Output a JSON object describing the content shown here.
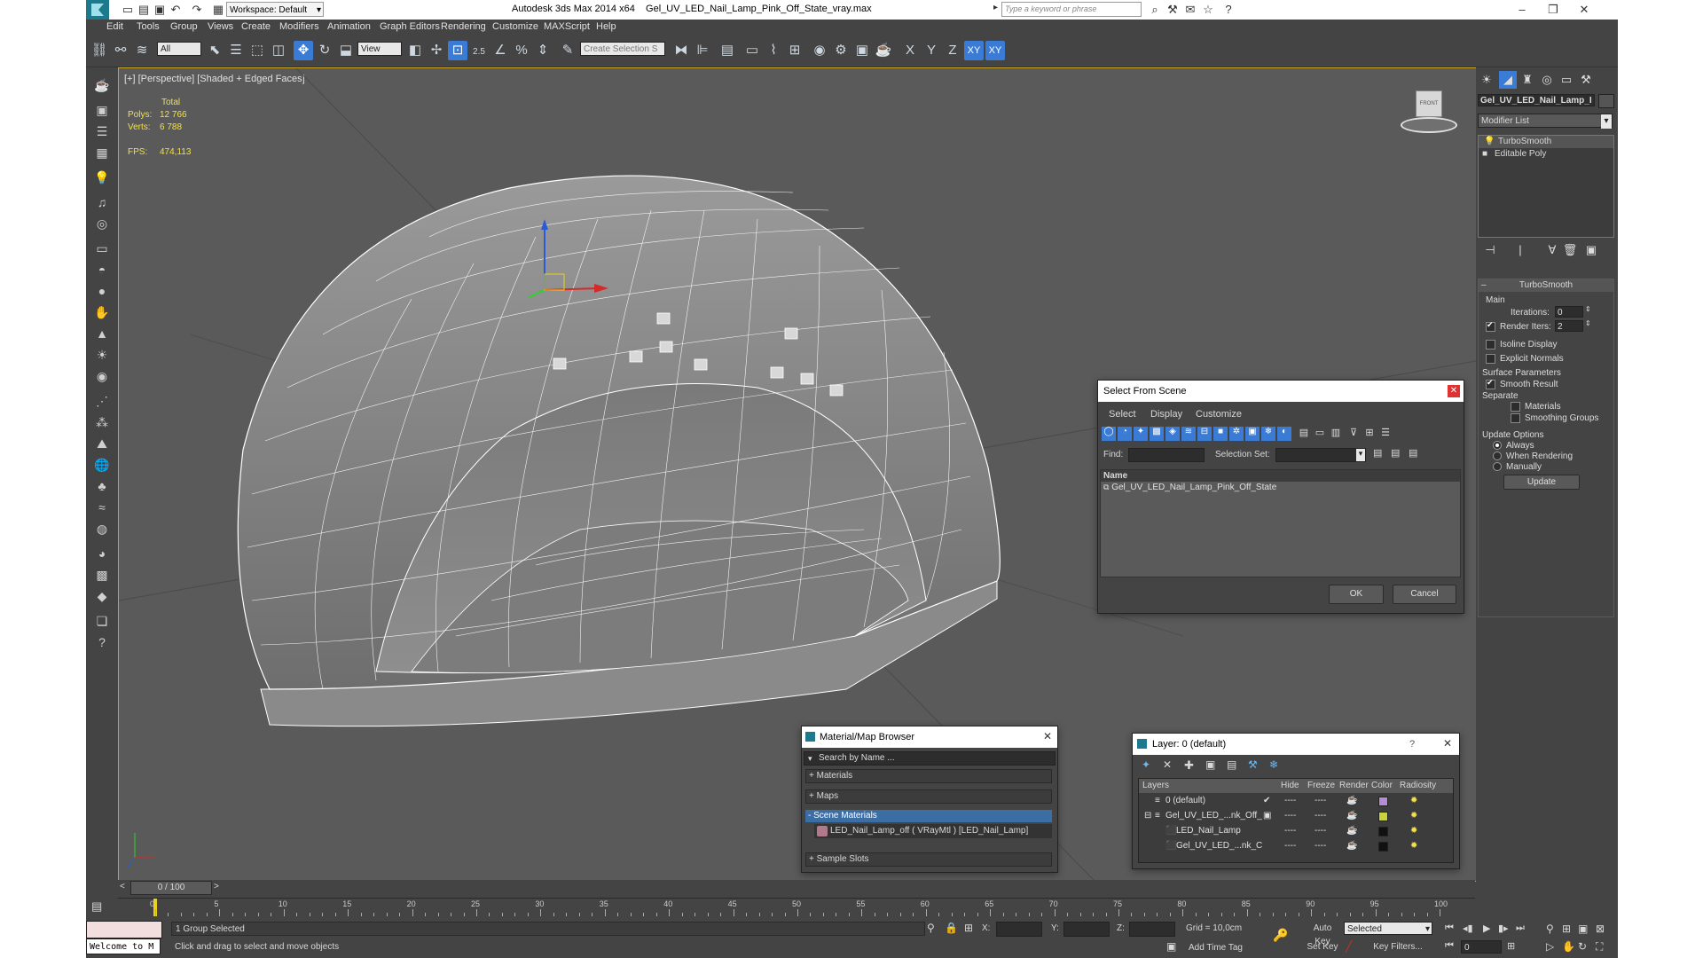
{
  "app": {
    "title": "Autodesk 3ds Max  2014 x64",
    "filename": "Gel_UV_LED_Nail_Lamp_Pink_Off_State_vray.max",
    "workspace": "Workspace: Default",
    "search_placeholder": "Type a keyword or phrase"
  },
  "menu": [
    "Edit",
    "Tools",
    "Group",
    "Views",
    "Create",
    "Modifiers",
    "Animation",
    "Graph Editors",
    "Rendering",
    "Customize",
    "MAXScript",
    "Help"
  ],
  "toolbar": {
    "filter_select": "All",
    "refcoord_select": "View",
    "snap_label": "2.5",
    "selection_set_placeholder": "Create Selection S",
    "axis_buttons": [
      "X",
      "Y",
      "Z",
      "XY",
      "XY"
    ]
  },
  "viewport": {
    "label": "[+] [Perspective] [Shaded + Edged Faces]",
    "stats": {
      "total_label": "Total",
      "polys_label": "Polys:",
      "polys_value": "12 766",
      "verts_label": "Verts:",
      "verts_value": "6 788",
      "fps_label": "FPS:",
      "fps_value": "474,113"
    },
    "viewcube_label": "FRONT"
  },
  "command_panel": {
    "object_name": "Gel_UV_LED_Nail_Lamp_I",
    "modifier_list": "Modifier List",
    "stack": [
      "TurboSmooth",
      "Editable Poly"
    ],
    "rollout_title": "TurboSmooth",
    "main_label": "Main",
    "iterations_label": "Iterations:",
    "iterations_value": "0",
    "render_iters_label": "Render Iters:",
    "render_iters_value": "2",
    "isoline_label": "Isoline Display",
    "explicit_normals_label": "Explicit Normals",
    "surface_params_label": "Surface Parameters",
    "smooth_result_label": "Smooth Result",
    "separate_label": "Separate",
    "materials_label": "Materials",
    "smoothing_groups_label": "Smoothing Groups",
    "update_options_label": "Update Options",
    "always_label": "Always",
    "when_rendering_label": "When Rendering",
    "manually_label": "Manually",
    "update_button": "Update"
  },
  "select_from_scene": {
    "title": "Select From Scene",
    "menu": [
      "Select",
      "Display",
      "Customize"
    ],
    "find_label": "Find:",
    "selection_set_label": "Selection Set:",
    "column_name": "Name",
    "items": [
      "Gel_UV_LED_Nail_Lamp_Pink_Off_State"
    ],
    "ok": "OK",
    "cancel": "Cancel"
  },
  "material_browser": {
    "title": "Material/Map Browser",
    "search_placeholder": "Search by Name ...",
    "sections": [
      "+ Materials",
      "+ Maps",
      "- Scene Materials"
    ],
    "scene_material": "LED_Nail_Lamp_off  ( VRayMtl ) [LED_Nail_Lamp]",
    "sample_slots": "+ Sample Slots"
  },
  "layer_dialog": {
    "title": "Layer: 0 (default)",
    "help": "?",
    "columns": [
      "Layers",
      "Hide",
      "Freeze",
      "Render",
      "Color",
      "Radiosity"
    ],
    "rows": [
      {
        "name": "0 (default)",
        "color": "#b48cd8"
      },
      {
        "name": "Gel_UV_LED_...nk_Off_",
        "color": "#c8d23c"
      },
      {
        "name": "LED_Nail_Lamp",
        "color": "#111111"
      },
      {
        "name": "Gel_UV_LED_...nk_C",
        "color": "#111111"
      }
    ]
  },
  "timeline": {
    "frame_counter": "0 / 100",
    "ticks": [
      "0",
      "5",
      "10",
      "15",
      "20",
      "25",
      "30",
      "35",
      "40",
      "45",
      "50",
      "55",
      "60",
      "65",
      "70",
      "75",
      "80",
      "85",
      "90",
      "95",
      "100"
    ]
  },
  "status": {
    "maxscript_text": "Welcome to M",
    "selection_text": "1 Group Selected",
    "prompt_text": "Click and drag to select and move objects",
    "x_label": "X:",
    "y_label": "Y:",
    "z_label": "Z:",
    "grid_text": "Grid = 10,0cm",
    "add_time_tag": "Add Time Tag",
    "auto_key": "Auto Key",
    "set_key": "Set Key",
    "selected_dropdown": "Selected",
    "key_filters": "Key Filters...",
    "frame_value": "0"
  },
  "colors": {
    "accent": "#3a7bd5",
    "viewport_bg": "#5a5a5a",
    "ui_bg": "#444444",
    "stats_text": "#f2e14c",
    "viewport_border": "#c8a52a"
  }
}
